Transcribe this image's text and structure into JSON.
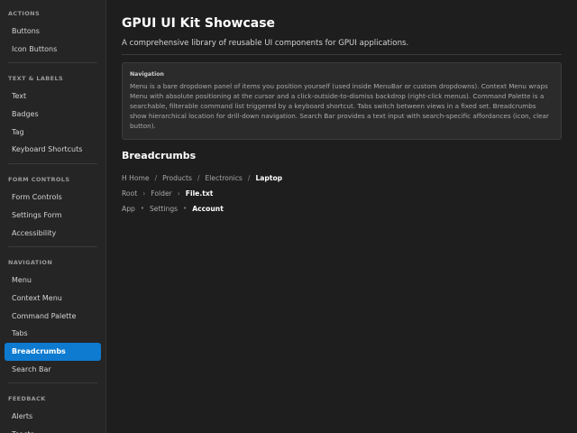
{
  "sidebar": {
    "sections": [
      {
        "title": "ACTIONS",
        "items": [
          "Buttons",
          "Icon Buttons"
        ]
      },
      {
        "title": "TEXT & LABELS",
        "items": [
          "Text",
          "Badges",
          "Tag",
          "Keyboard Shortcuts"
        ]
      },
      {
        "title": "FORM CONTROLS",
        "items": [
          "Form Controls",
          "Settings Form",
          "Accessibility"
        ]
      },
      {
        "title": "NAVIGATION",
        "items": [
          "Menu",
          "Context Menu",
          "Command Palette",
          "Tabs",
          "Breadcrumbs",
          "Search Bar"
        ]
      },
      {
        "title": "FEEDBACK",
        "items": [
          "Alerts",
          "Toasts"
        ]
      }
    ],
    "active_item": "Breadcrumbs"
  },
  "main": {
    "title": "GPUI UI Kit Showcase",
    "subtitle": "A comprehensive library of reusable UI components for GPUI applications.",
    "info": {
      "title": "Navigation",
      "text": "Menu is a bare dropdown panel of items you position yourself (used inside MenuBar or custom dropdowns). Context Menu wraps Menu with absolute positioning at the cursor and a click-outside-to-dismiss backdrop (right-click menus). Command Palette is a searchable, filterable command list triggered by a keyboard shortcut. Tabs switch between views in a fixed set. Breadcrumbs show hierarchical location for drill-down navigation. Search Bar provides a text input with search-specific affordances (icon, clear button)."
    },
    "breadcrumbs_heading": "Breadcrumbs",
    "breadcrumb_rows": [
      {
        "separator": "/",
        "items": [
          "H Home",
          "Products",
          "Electronics",
          "Laptop"
        ]
      },
      {
        "separator": "›",
        "items": [
          "Root",
          "Folder",
          "File.txt"
        ]
      },
      {
        "separator": "•",
        "items": [
          "App",
          "Settings",
          "Account"
        ]
      }
    ]
  },
  "colors": {
    "accent": "#0e7bd1",
    "background": "#1e1e1e",
    "sidebar": "#252526"
  }
}
